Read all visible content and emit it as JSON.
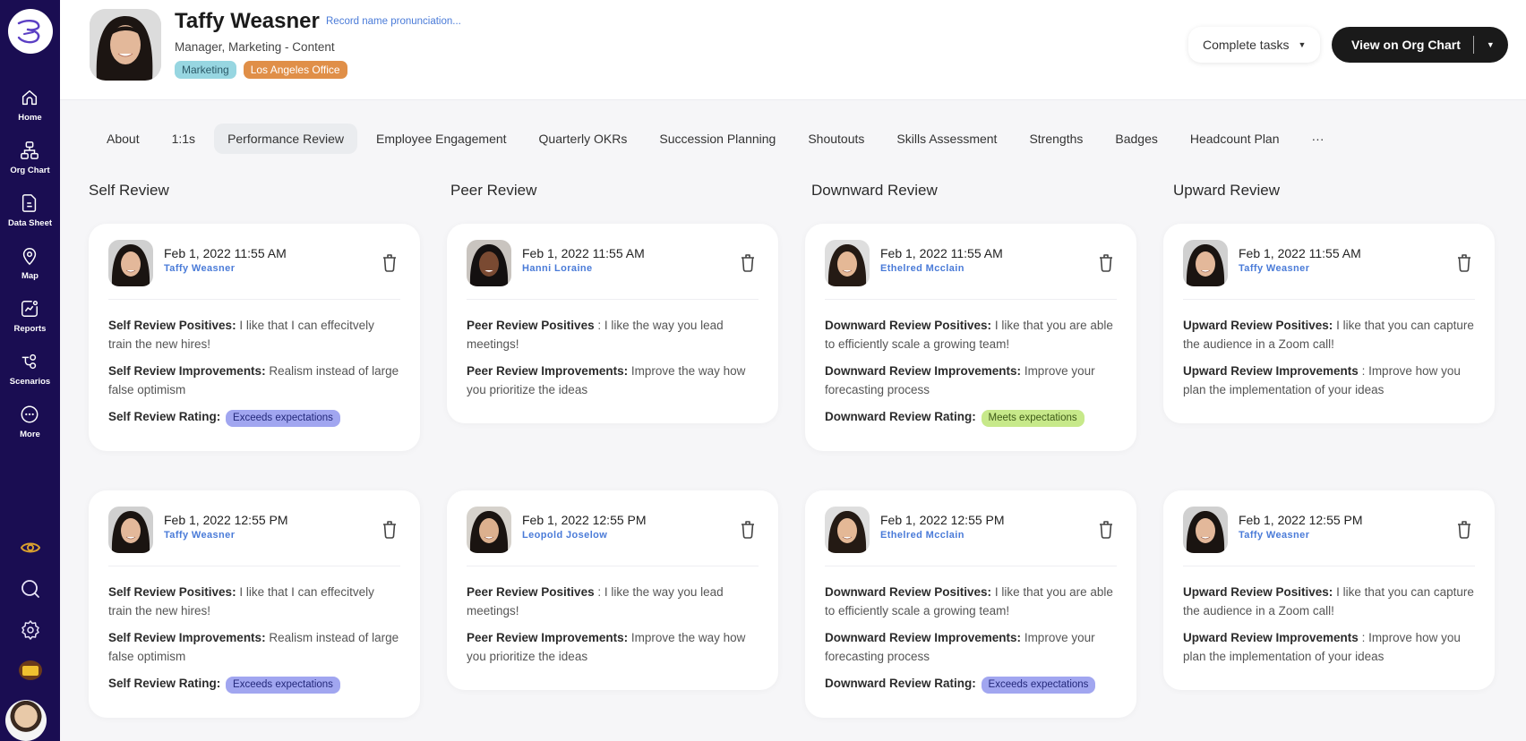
{
  "sidebar": {
    "items": [
      {
        "label": "Home",
        "icon": "home-icon"
      },
      {
        "label": "Org Chart",
        "icon": "org-chart-icon"
      },
      {
        "label": "Data Sheet",
        "icon": "data-sheet-icon"
      },
      {
        "label": "Map",
        "icon": "map-pin-icon"
      },
      {
        "label": "Reports",
        "icon": "reports-icon"
      },
      {
        "label": "Scenarios",
        "icon": "scenarios-icon"
      },
      {
        "label": "More",
        "icon": "more-icon"
      }
    ],
    "bottom_icons": [
      "eye-icon",
      "search-icon",
      "gear-icon",
      "bonus-icon",
      "user-avatar"
    ]
  },
  "header": {
    "name": "Taffy Weasner",
    "pronunciation_link": "Record name pronunciation...",
    "job_title": "Manager, Marketing - Content",
    "tags": [
      "Marketing",
      "Los Angeles Office"
    ],
    "complete_tasks_label": "Complete tasks",
    "view_org_chart_label": "View on Org Chart"
  },
  "tabs": [
    {
      "label": "About",
      "active": false
    },
    {
      "label": "1:1s",
      "active": false
    },
    {
      "label": "Performance Review",
      "active": true
    },
    {
      "label": "Employee Engagement",
      "active": false
    },
    {
      "label": "Quarterly OKRs",
      "active": false
    },
    {
      "label": "Succession Planning",
      "active": false
    },
    {
      "label": "Shoutouts",
      "active": false
    },
    {
      "label": "Skills Assessment",
      "active": false
    },
    {
      "label": "Strengths",
      "active": false
    },
    {
      "label": "Badges",
      "active": false
    },
    {
      "label": "Headcount Plan",
      "active": false
    },
    {
      "label": "···",
      "active": false
    }
  ],
  "columns": [
    {
      "title": "Self Review",
      "cards": [
        {
          "date": "Feb 1, 2022 11:55 AM",
          "reviewer": "Taffy Weasner",
          "fields": [
            {
              "label": "Self Review Positives:",
              "value": " I like that I can effecitvely train the new hires!"
            },
            {
              "label": "Self Review Improvements:",
              "value": " Realism instead of large false optimism"
            }
          ],
          "rating_label": "Self Review Rating:",
          "rating": "Exceeds expectations",
          "rating_type": "exceeds"
        },
        {
          "date": "Feb 1, 2022 12:55 PM",
          "reviewer": "Taffy Weasner",
          "fields": [
            {
              "label": "Self Review Positives:",
              "value": " I like that I can effecitvely train the new hires!"
            },
            {
              "label": "Self Review Improvements:",
              "value": " Realism instead of large false optimism"
            }
          ],
          "rating_label": "Self Review Rating:",
          "rating": "Exceeds expectations",
          "rating_type": "exceeds"
        }
      ]
    },
    {
      "title": "Peer Review",
      "cards": [
        {
          "date": "Feb 1, 2022 11:55 AM",
          "reviewer": "Hanni Loraine",
          "fields": [
            {
              "label": "Peer Review Positives",
              "value": " : I like the way you lead meetings!"
            },
            {
              "label": "Peer Review Improvements:",
              "value": " Improve the way how you prioritize the ideas"
            }
          ]
        },
        {
          "date": "Feb 1, 2022 12:55 PM",
          "reviewer": "Leopold Joselow",
          "fields": [
            {
              "label": "Peer Review Positives",
              "value": " : I like the way you lead meetings!"
            },
            {
              "label": "Peer Review Improvements:",
              "value": " Improve the way how you prioritize the ideas"
            }
          ]
        }
      ]
    },
    {
      "title": "Downward Review",
      "cards": [
        {
          "date": "Feb 1, 2022 11:55 AM",
          "reviewer": "Ethelred Mcclain",
          "fields": [
            {
              "label": "Downward Review Positives:",
              "value": " I like that you are able to efficiently scale a growing team!"
            },
            {
              "label": "Downward Review Improvements:",
              "value": " Improve your forecasting process"
            }
          ],
          "rating_label": "Downward Review Rating:",
          "rating": "Meets expectations",
          "rating_type": "meets"
        },
        {
          "date": "Feb 1, 2022 12:55 PM",
          "reviewer": "Ethelred Mcclain",
          "fields": [
            {
              "label": "Downward Review Positives:",
              "value": " I like that you are able to efficiently scale a growing team!"
            },
            {
              "label": "Downward Review Improvements:",
              "value": " Improve your forecasting process"
            }
          ],
          "rating_label": "Downward Review Rating:",
          "rating": "Exceeds expectations",
          "rating_type": "exceeds"
        }
      ]
    },
    {
      "title": "Upward Review",
      "cards": [
        {
          "date": "Feb 1, 2022 11:55 AM",
          "reviewer": "Taffy Weasner",
          "fields": [
            {
              "label": "Upward Review Positives:",
              "value": " I like that you can capture the audience in a Zoom call!"
            },
            {
              "label": "Upward Review Improvements",
              "value": " : Improve how you plan the implementation of your ideas"
            }
          ]
        },
        {
          "date": "Feb 1, 2022 12:55 PM",
          "reviewer": "Taffy Weasner",
          "fields": [
            {
              "label": "Upward Review Positives:",
              "value": " I like that you can capture the audience in a Zoom call!"
            },
            {
              "label": "Upward Review Improvements",
              "value": " : Improve how you plan the implementation of your ideas"
            }
          ]
        }
      ]
    }
  ],
  "colors": {
    "sidebar_bg": "#1a0d52",
    "link_blue": "#4a7bd8",
    "exceeds_badge": "#a1a6f0",
    "meets_badge": "#c7e98a",
    "marketing_tag": "#97d6e1",
    "office_tag": "#e08f48"
  }
}
